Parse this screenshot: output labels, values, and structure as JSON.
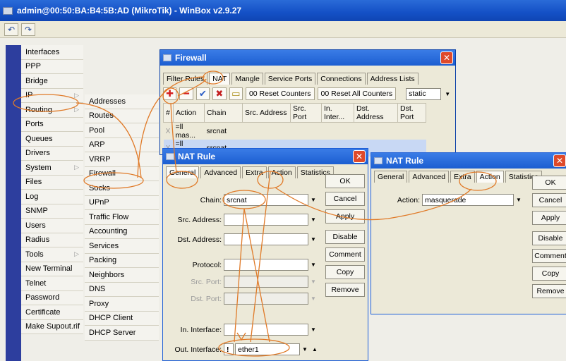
{
  "window_title": "admin@00:50:BA:B4:5B:AD (MikroTik) - WinBox v2.9.27",
  "toolbar": {
    "undo_icon": "↶",
    "redo_icon": "↷"
  },
  "main_menu": [
    "Interfaces",
    "PPP",
    "Bridge",
    "IP",
    "Routing",
    "Ports",
    "Queues",
    "Drivers",
    "System",
    "Files",
    "Log",
    "SNMP",
    "Users",
    "Radius",
    "Tools",
    "New Terminal",
    "Telnet",
    "Password",
    "Certificate",
    "Make Supout.rif"
  ],
  "sub_menu": [
    "Addresses",
    "Routes",
    "Pool",
    "ARP",
    "VRRP",
    "Firewall",
    "Socks",
    "UPnP",
    "Traffic Flow",
    "Accounting",
    "Services",
    "Packing",
    "Neighbors",
    "DNS",
    "Proxy",
    "DHCP Client",
    "DHCP Server"
  ],
  "firewall": {
    "title": "Firewall",
    "tabs": [
      "Filter Rules",
      "NAT",
      "Mangle",
      "Service Ports",
      "Connections",
      "Address Lists"
    ],
    "reset_counters": "00 Reset Counters",
    "reset_all_counters": "00 Reset All Counters",
    "filter_value": "static",
    "columns": [
      "#",
      "Action",
      "Chain",
      "Src. Address",
      "Src. Port",
      "In. Inter...",
      "Dst. Address",
      "Dst. Port"
    ],
    "rows": [
      {
        "num": "X",
        "action": "=ll mas...",
        "chain": "srcnat"
      },
      {
        "num": "X",
        "action": "=ll mas...",
        "chain": "srcnat"
      }
    ]
  },
  "nat_rule_1": {
    "title": "NAT Rule",
    "tabs": [
      "General",
      "Advanced",
      "Extra",
      "Action",
      "Statistics"
    ],
    "chain_label": "Chain:",
    "chain_value": "srcnat",
    "src_address_label": "Src. Address:",
    "dst_address_label": "Dst. Address:",
    "protocol_label": "Protocol:",
    "src_port_label": "Src. Port:",
    "dst_port_label": "Dst. Port:",
    "in_interface_label": "In. Interface:",
    "out_interface_label": "Out. Interface:",
    "out_interface_value": "ether1",
    "negate_mark": "!",
    "buttons": [
      "OK",
      "Cancel",
      "Apply",
      "Disable",
      "Comment",
      "Copy",
      "Remove"
    ]
  },
  "nat_rule_2": {
    "title": "NAT Rule",
    "tabs": [
      "General",
      "Advanced",
      "Extra",
      "Action",
      "Statistics"
    ],
    "action_label": "Action:",
    "action_value": "masquerade",
    "buttons": [
      "OK",
      "Cancel",
      "Apply",
      "Disable",
      "Comment",
      "Copy",
      "Remove"
    ]
  }
}
